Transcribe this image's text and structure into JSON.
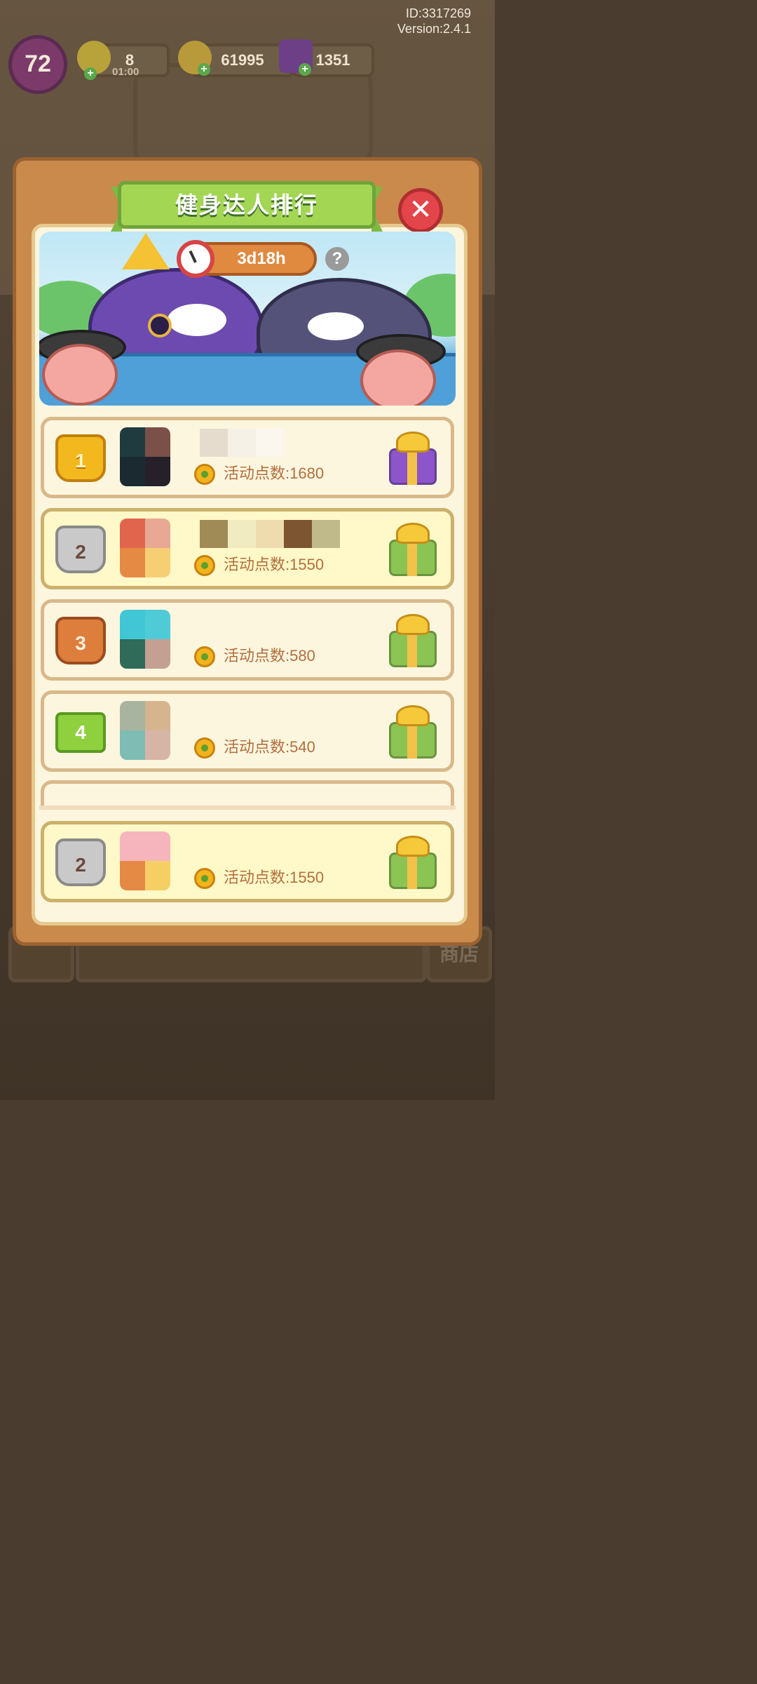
{
  "hud": {
    "id_text": "ID:3317269",
    "version_text": "Version:2.4.1",
    "level": "72",
    "energy": "8",
    "energy_timer": "01:00",
    "coins": "61995",
    "gems": "1351"
  },
  "background": {
    "shop_label": "商店"
  },
  "modal": {
    "title": "健身达人排行",
    "close_symbol": "✕",
    "timer": "3d18h",
    "help_symbol": "?"
  },
  "rankings": [
    {
      "rank": "1",
      "points_text": "活动点数:1680",
      "gift": "purple"
    },
    {
      "rank": "2",
      "points_text": "活动点数:1550",
      "gift": "green"
    },
    {
      "rank": "3",
      "points_text": "活动点数:580",
      "gift": "green"
    },
    {
      "rank": "4",
      "points_text": "活动点数:540",
      "gift": "green"
    }
  ],
  "my_rank": {
    "rank": "2",
    "points_text": "活动点数:1550",
    "gift": "green"
  },
  "colors": {
    "modal_frame": "#c98a4b",
    "title_banner": "#a3d653",
    "close_button": "#e2464a",
    "timer_pill": "#e08a40",
    "points_text": "#b26f3e"
  },
  "icons": {
    "close": "close-icon",
    "clock": "clock-icon",
    "help": "help-icon",
    "flower": "flower-icon",
    "gift": "gift-icon",
    "energy": "lightning-icon",
    "coin": "coin-icon",
    "gem": "gem-icon"
  }
}
